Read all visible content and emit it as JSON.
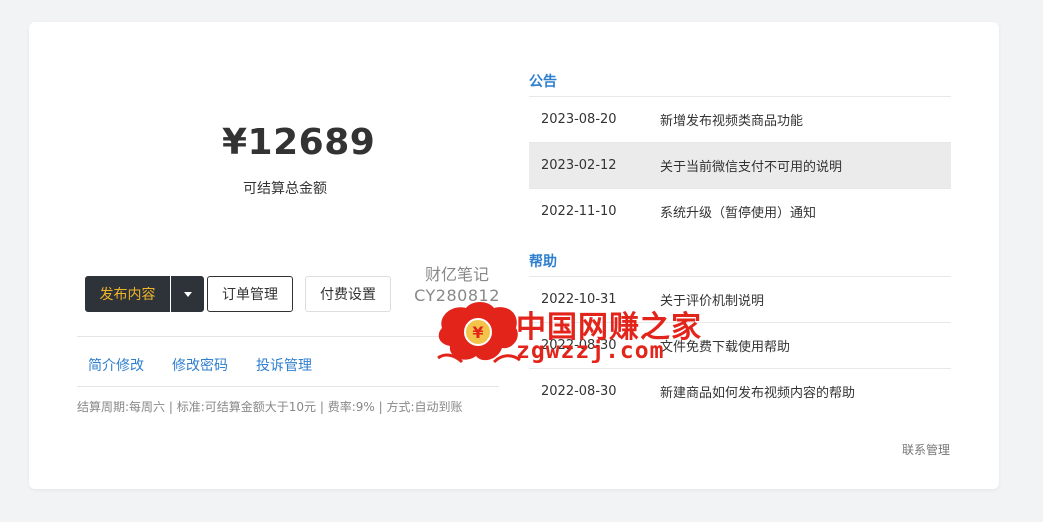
{
  "summary": {
    "amount": "¥12689",
    "amount_label": "可结算总金额"
  },
  "actions": {
    "publish": "发布内容",
    "orders": "订单管理",
    "fee_settings": "付费设置"
  },
  "watermark": {
    "line1": "财亿笔记",
    "line2": "CY280812",
    "brand_cn": "中国网赚之家",
    "brand_url": "zgwzzj.com",
    "logo_glyph": "¥"
  },
  "links": {
    "profile_edit": "简介修改",
    "password_edit": "修改密码",
    "complaints": "投诉管理"
  },
  "settlement_info": "结算周期:每周六 | 标准:可结算金额大于10元 | 费率:9% | 方式:自动到账",
  "announcements": {
    "title": "公告",
    "items": [
      {
        "date": "2023-08-20",
        "title": "新增发布视频类商品功能"
      },
      {
        "date": "2023-02-12",
        "title": "关于当前微信支付不可用的说明"
      },
      {
        "date": "2022-11-10",
        "title": "系统升级（暂停使用）通知"
      }
    ]
  },
  "help": {
    "title": "帮助",
    "items": [
      {
        "date": "2022-10-31",
        "title": "关于评价机制说明"
      },
      {
        "date": "2022-08-30",
        "title": "文件免费下载使用帮助"
      },
      {
        "date": "2022-08-30",
        "title": "新建商品如何发布视频内容的帮助"
      }
    ]
  },
  "contact_label": "联系管理",
  "colors": {
    "accent": "#2f7fcf",
    "publish_text": "#f0b429",
    "dark_button": "#2d3339",
    "brand_red": "#e3241b"
  }
}
